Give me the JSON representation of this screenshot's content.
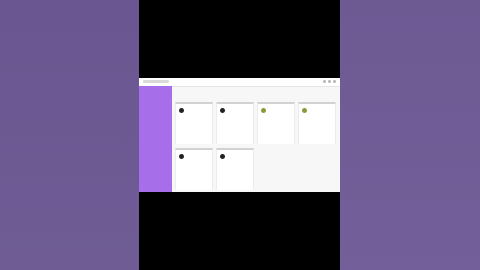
{
  "browser": {
    "address": ""
  },
  "cards": [
    {
      "title": "",
      "subtitle": "",
      "avatar": "dark"
    },
    {
      "title": "",
      "subtitle": "",
      "avatar": "dark"
    },
    {
      "title": "",
      "subtitle": "",
      "avatar": "olive"
    },
    {
      "title": "",
      "subtitle": "",
      "avatar": "olive"
    },
    {
      "title": "",
      "subtitle": "",
      "avatar": "dark"
    },
    {
      "title": "",
      "subtitle": "",
      "avatar": "dark"
    }
  ],
  "card_actions": {
    "first": "",
    "second": ""
  },
  "colors": {
    "sidebar": "#a66ee8",
    "background": "#6d5a93"
  }
}
